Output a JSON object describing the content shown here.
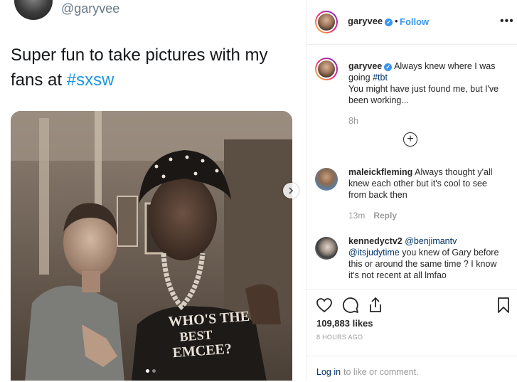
{
  "tweet": {
    "handle": "@garyvee",
    "text_main": "Super fun to take pictures with my fans at ",
    "text_hashtag": "#sxsw"
  },
  "photo": {
    "shirt_text_line1": "WHO'S THE",
    "shirt_text_line2": "BEST",
    "shirt_text_line3": "EMCEE?",
    "carousel_total": 2,
    "carousel_index": 1
  },
  "header": {
    "username": "garyvee",
    "separator": "•",
    "follow_label": "Follow",
    "more_icon": "more-options-icon",
    "more_glyph": "•••"
  },
  "caption": {
    "username": "garyvee",
    "text_before_tag": "Always knew where I was going ",
    "tag": "#tbt",
    "text_after_tag": "You might have just found me, but I've been working...",
    "time": "8h",
    "load_more_glyph": "+"
  },
  "comments": [
    {
      "username": "maleickfleming",
      "text": "Always thought y'all knew each other but it's cool to see from back then",
      "time": "13m",
      "reply_label": "Reply"
    },
    {
      "username": "kennedyctv2",
      "mention1": "@benjimantv",
      "mention2": "@itsjudytime",
      "text": " you knew of Gary before this or around the same time ? I know it's not recent at all lmfao"
    }
  ],
  "actions": {
    "likes": "109,883 likes",
    "time_ago": "8 HOURS AGO"
  },
  "login": {
    "link_label": "Log in",
    "rest_text": "to like or comment."
  },
  "colors": {
    "link_blue": "#3897f0",
    "tweet_blue": "#1b95e0",
    "mention_navy": "#003569",
    "muted_gray": "#999999"
  }
}
